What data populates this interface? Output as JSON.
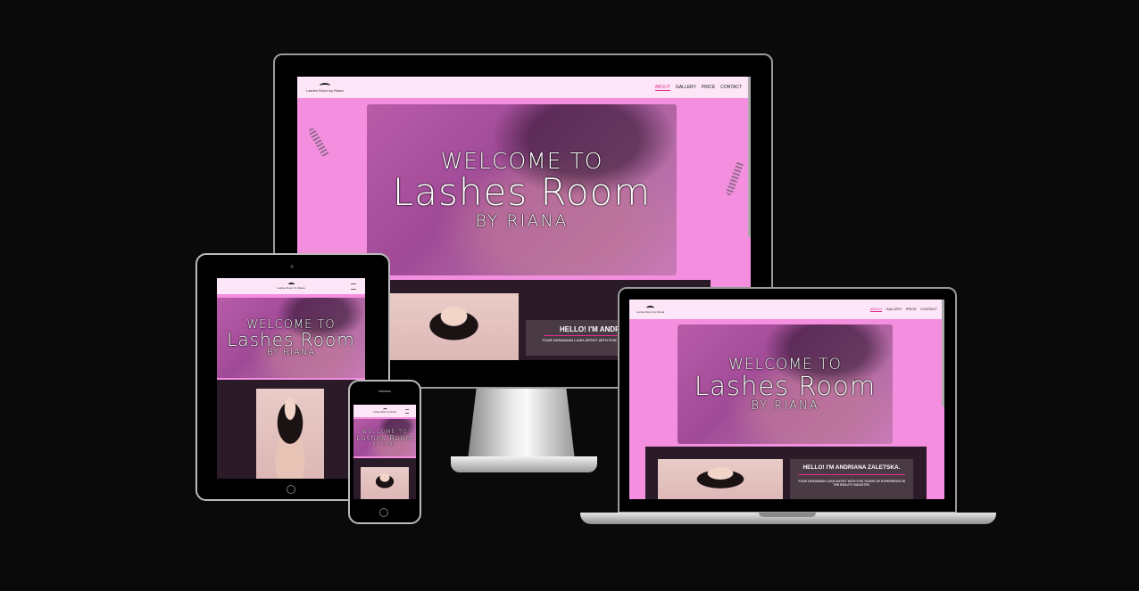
{
  "site": {
    "logo_text": "Lashes Room by Riana",
    "nav": [
      "ABOUT",
      "GALLERY",
      "PRICE",
      "CONTACT"
    ],
    "hero": {
      "line1": "WELCOME TO",
      "line2": "Lashes Room",
      "line3": "BY RIANA"
    },
    "about": {
      "hello": "HELLO! I'M ANDRIANA ZALETSKA.",
      "hello_cropped": "HELLO! I'M ANDRIA",
      "intro": "YOUR UKRAINIAN LASH ARTIST WITH FIVE YEARS OF EXPERIENCE IN THE BEAUTY INDUSTRY.",
      "intro_cropped": "YOUR UKRAINIAN LASH ARTIST WITH FIVE YEARS OF"
    }
  },
  "colors": {
    "background": "#0b0a0b",
    "site_pink": "#f48fe0",
    "nav_bg": "#fde6f8",
    "accent": "#e0308c"
  },
  "devices": [
    "desktop-monitor",
    "laptop",
    "tablet",
    "phone"
  ]
}
